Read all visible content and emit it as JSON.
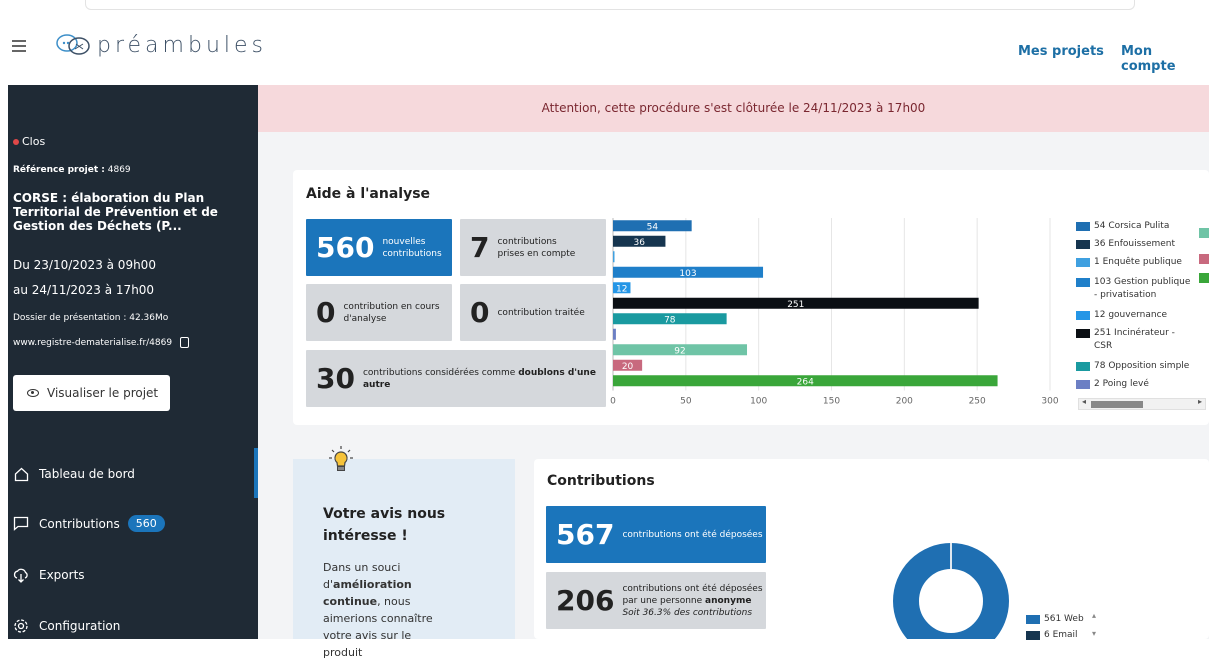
{
  "header": {
    "brand": "préambules",
    "nav": [
      "Mes projets",
      "Mon compte"
    ]
  },
  "sidebar": {
    "status": "Clos",
    "reference_label": "Référence projet :",
    "reference_value": "4869",
    "project_title": "CORSE : élaboration du Plan Territorial de Prévention et de Gestion des Déchets (P...",
    "date_start": "Du 23/10/2023 à 09h00",
    "date_end": "au 24/11/2023 à 17h00",
    "dossier": "Dossier de présentation : 42.36Mo",
    "url": "www.registre-dematerialise.fr/4869",
    "view_button": "Visualiser le projet",
    "nav": [
      {
        "label": "Tableau de bord"
      },
      {
        "label": "Contributions",
        "badge": "560"
      },
      {
        "label": "Exports"
      },
      {
        "label": "Configuration"
      }
    ]
  },
  "alert": "Attention, cette procédure s'est clôturée le 24/11/2023 à 17h00",
  "analyse": {
    "title": "Aide à l'analyse",
    "tiles": [
      {
        "num": "560",
        "label": "nouvelles contributions"
      },
      {
        "num": "7",
        "label": "contributions prises en compte"
      },
      {
        "num": "0",
        "label": "contribution en cours d'analyse"
      },
      {
        "num": "0",
        "label": "contribution traitée"
      },
      {
        "num": "30",
        "label_pre": "contributions considérées comme ",
        "label_bold": "doublons d'une autre"
      }
    ]
  },
  "chart_data": {
    "type": "bar",
    "orientation": "horizontal",
    "categories": [
      "Corsica Pulita",
      "Enfouissement",
      "Enquête publique",
      "Gestion publique - privatisation",
      "gouvernance",
      "Incinérateur - CSR",
      "Opposition simple",
      "Poing levé",
      "",
      "",
      ""
    ],
    "values": [
      54,
      36,
      1,
      103,
      12,
      251,
      78,
      2,
      92,
      20,
      264
    ],
    "data_labels": [
      "54",
      "36",
      "",
      "103",
      "12",
      "251",
      "78",
      "",
      "92",
      "20",
      "264"
    ],
    "colors": [
      "#1f6fb2",
      "#16354f",
      "#3fa0e0",
      "#1f7fc9",
      "#2596e6",
      "#0b0f14",
      "#1a9aa0",
      "#6c7fc4",
      "#6fc4a6",
      "#c8697e",
      "#3aa63a"
    ],
    "xlim": [
      0,
      300
    ],
    "xticks": [
      0,
      50,
      100,
      150,
      200,
      250,
      300
    ],
    "grid": true,
    "legend": [
      {
        "label": "54 Corsica Pulita",
        "color": "#1f6fb2"
      },
      {
        "label": "36 Enfouissement",
        "color": "#16354f"
      },
      {
        "label": "1 Enquête publique",
        "color": "#3fa0e0"
      },
      {
        "label": "103 Gestion publique - privatisation",
        "color": "#1f7fc9"
      },
      {
        "label": "12 gouvernance",
        "color": "#2596e6"
      },
      {
        "label": "251 Incinérateur - CSR",
        "color": "#0b0f14"
      },
      {
        "label": "78 Opposition simple",
        "color": "#1a9aa0"
      },
      {
        "label": "2 Poing levé",
        "color": "#6c7fc4"
      }
    ],
    "legend_placement": "right"
  },
  "tip": {
    "title": "Votre avis nous intéresse !",
    "text_pre": "Dans un souci d'",
    "text_bold": "amélioration continue",
    "text_post": ", nous aimerions connaître votre avis sur le produit"
  },
  "contributions": {
    "title": "Contributions",
    "tiles": [
      {
        "num": "567",
        "label": "contributions ont été déposées"
      },
      {
        "num": "206",
        "label_pre": "contributions ont été déposées par une personne ",
        "label_bold": "anonyme",
        "label_italic": "Soit 36.3% des contributions"
      }
    ],
    "donut": {
      "slices": [
        {
          "label": "561 Web",
          "value": 561,
          "color": "#1f6fb2"
        },
        {
          "label": "6 Email",
          "value": 6,
          "color": "#16354f"
        }
      ]
    }
  },
  "colors": {
    "primary": "#1b75bb",
    "sidebar": "#1f2a35",
    "alert_bg": "#f6d9dc"
  }
}
